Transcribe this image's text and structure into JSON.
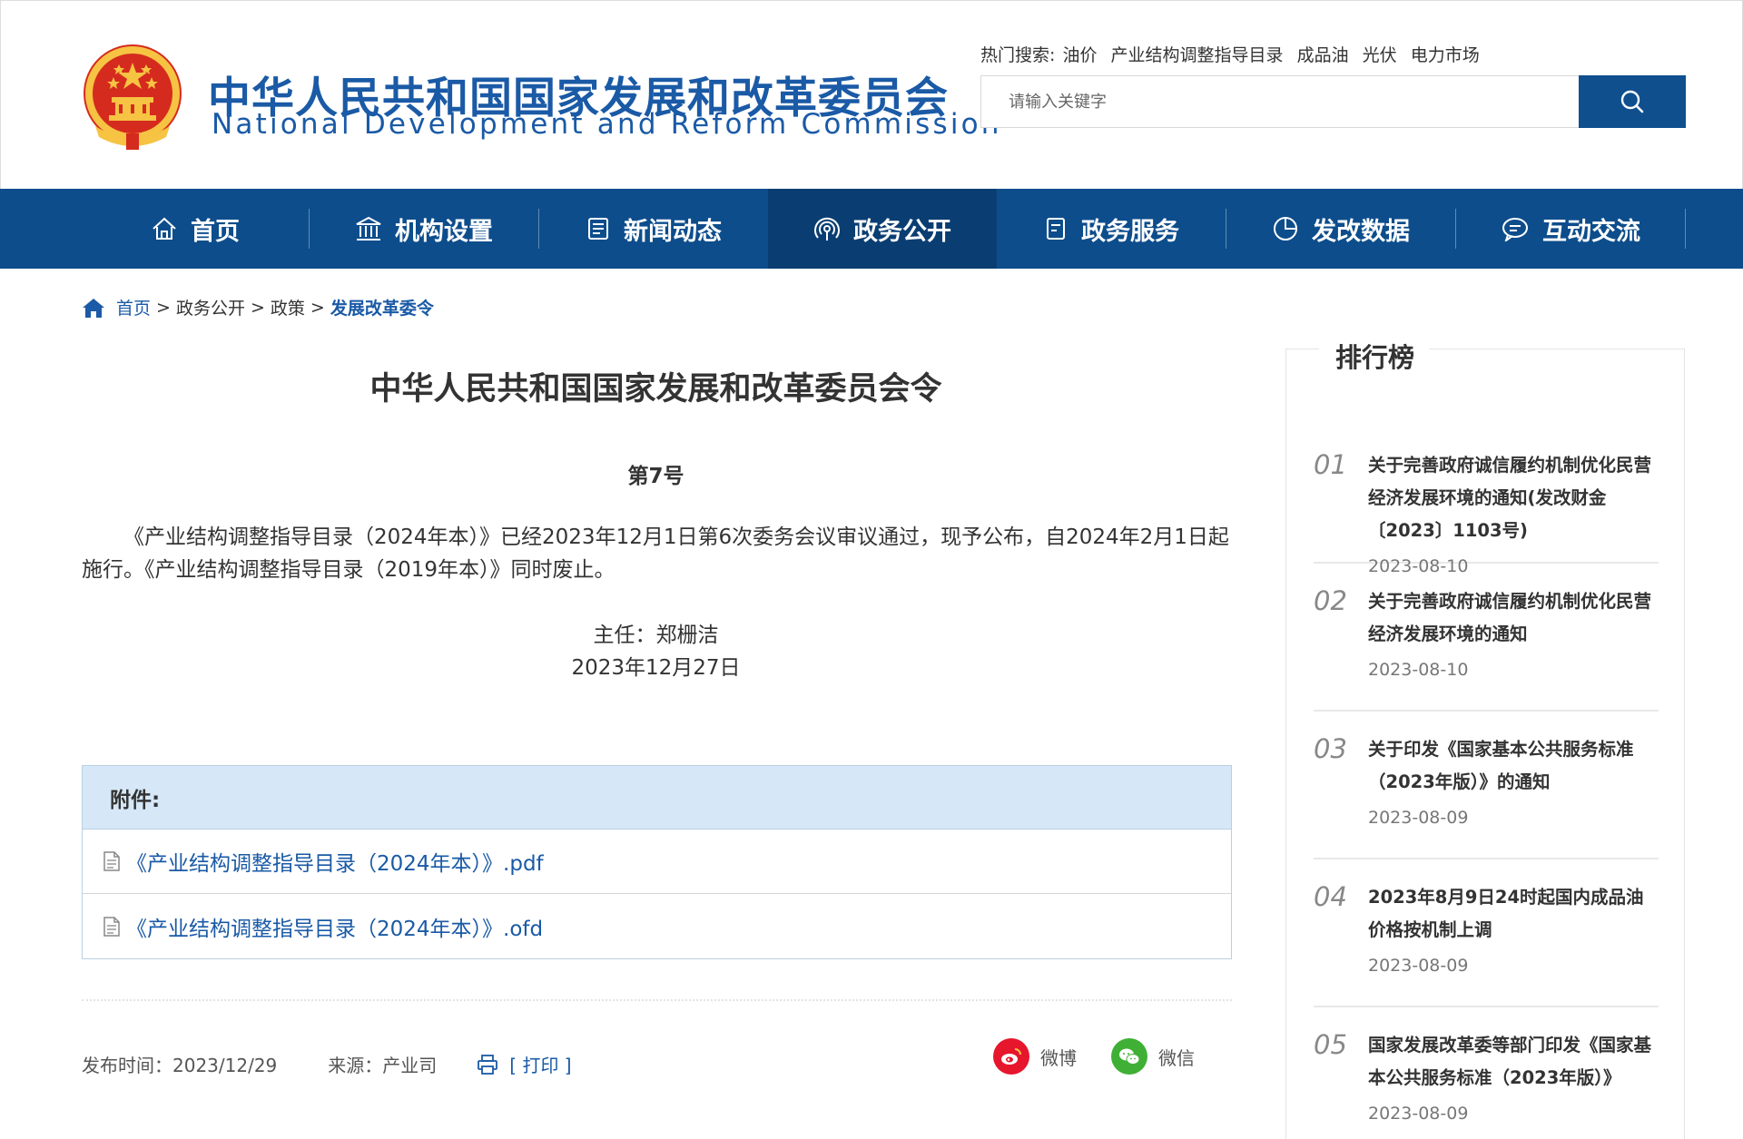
{
  "header": {
    "title_cn": "中华人民共和国国家发展和改革委员会",
    "title_en": "National Development and Reform Commission",
    "hot_search_label": "热门搜索:",
    "hot_terms": [
      "油价",
      "产业结构调整指导目录",
      "成品油",
      "光伏",
      "电力市场"
    ],
    "search_placeholder": "请输入关键字"
  },
  "nav": {
    "items": [
      {
        "label": "首页",
        "icon": "home-icon"
      },
      {
        "label": "机构设置",
        "icon": "institution-icon"
      },
      {
        "label": "新闻动态",
        "icon": "news-icon"
      },
      {
        "label": "政务公开",
        "icon": "broadcast-icon"
      },
      {
        "label": "政务服务",
        "icon": "service-icon"
      },
      {
        "label": "发改数据",
        "icon": "pie-chart-icon"
      },
      {
        "label": "互动交流",
        "icon": "chat-icon"
      }
    ],
    "active_index": 3
  },
  "breadcrumb": {
    "items": [
      "首页",
      "政务公开",
      "政策",
      "发展改革委令"
    ],
    "separator": ">"
  },
  "article": {
    "title": "中华人民共和国国家发展和改革委员会令",
    "number": "第7号",
    "body": "《产业结构调整指导目录（2024年本）》已经2023年12月1日第6次委务会议审议通过，现予公布，自2024年2月1日起施行。《产业结构调整指导目录（2019年本）》同时废止。",
    "signer": "主任：郑栅洁",
    "sign_date": "2023年12月27日"
  },
  "attachments": {
    "heading": "附件:",
    "files": [
      "《产业结构调整指导目录（2024年本）》.pdf",
      "《产业结构调整指导目录（2024年本）》.ofd"
    ]
  },
  "meta": {
    "publish": "发布时间：2023/12/29",
    "source": "来源：产业司",
    "print": "[ 打印 ]"
  },
  "share": {
    "weibo": "微博",
    "wechat": "微信"
  },
  "sidebar": {
    "title": "排行榜",
    "items": [
      {
        "num": "01",
        "text": "关于完善政府诚信履约机制优化民营经济发展环境的通知(发改财金〔2023〕1103号)",
        "date": "2023-08-10"
      },
      {
        "num": "02",
        "text": "关于完善政府诚信履约机制优化民营经济发展环境的通知",
        "date": "2023-08-10"
      },
      {
        "num": "03",
        "text": "关于印发《国家基本公共服务标准（2023年版）》的通知",
        "date": "2023-08-09"
      },
      {
        "num": "04",
        "text": "2023年8月9日24时起国内成品油价格按机制上调",
        "date": "2023-08-09"
      },
      {
        "num": "05",
        "text": "国家发展改革委等部门印发《国家基本公共服务标准（2023年版）》",
        "date": "2023-08-09"
      }
    ]
  },
  "colors": {
    "brand_blue": "#0d4d8c",
    "active_nav": "#0a3e72",
    "link_blue": "#1a5aa6",
    "attach_head": "#d6e8f8",
    "weibo_red": "#e6162d",
    "wechat_green": "#3fb035"
  }
}
